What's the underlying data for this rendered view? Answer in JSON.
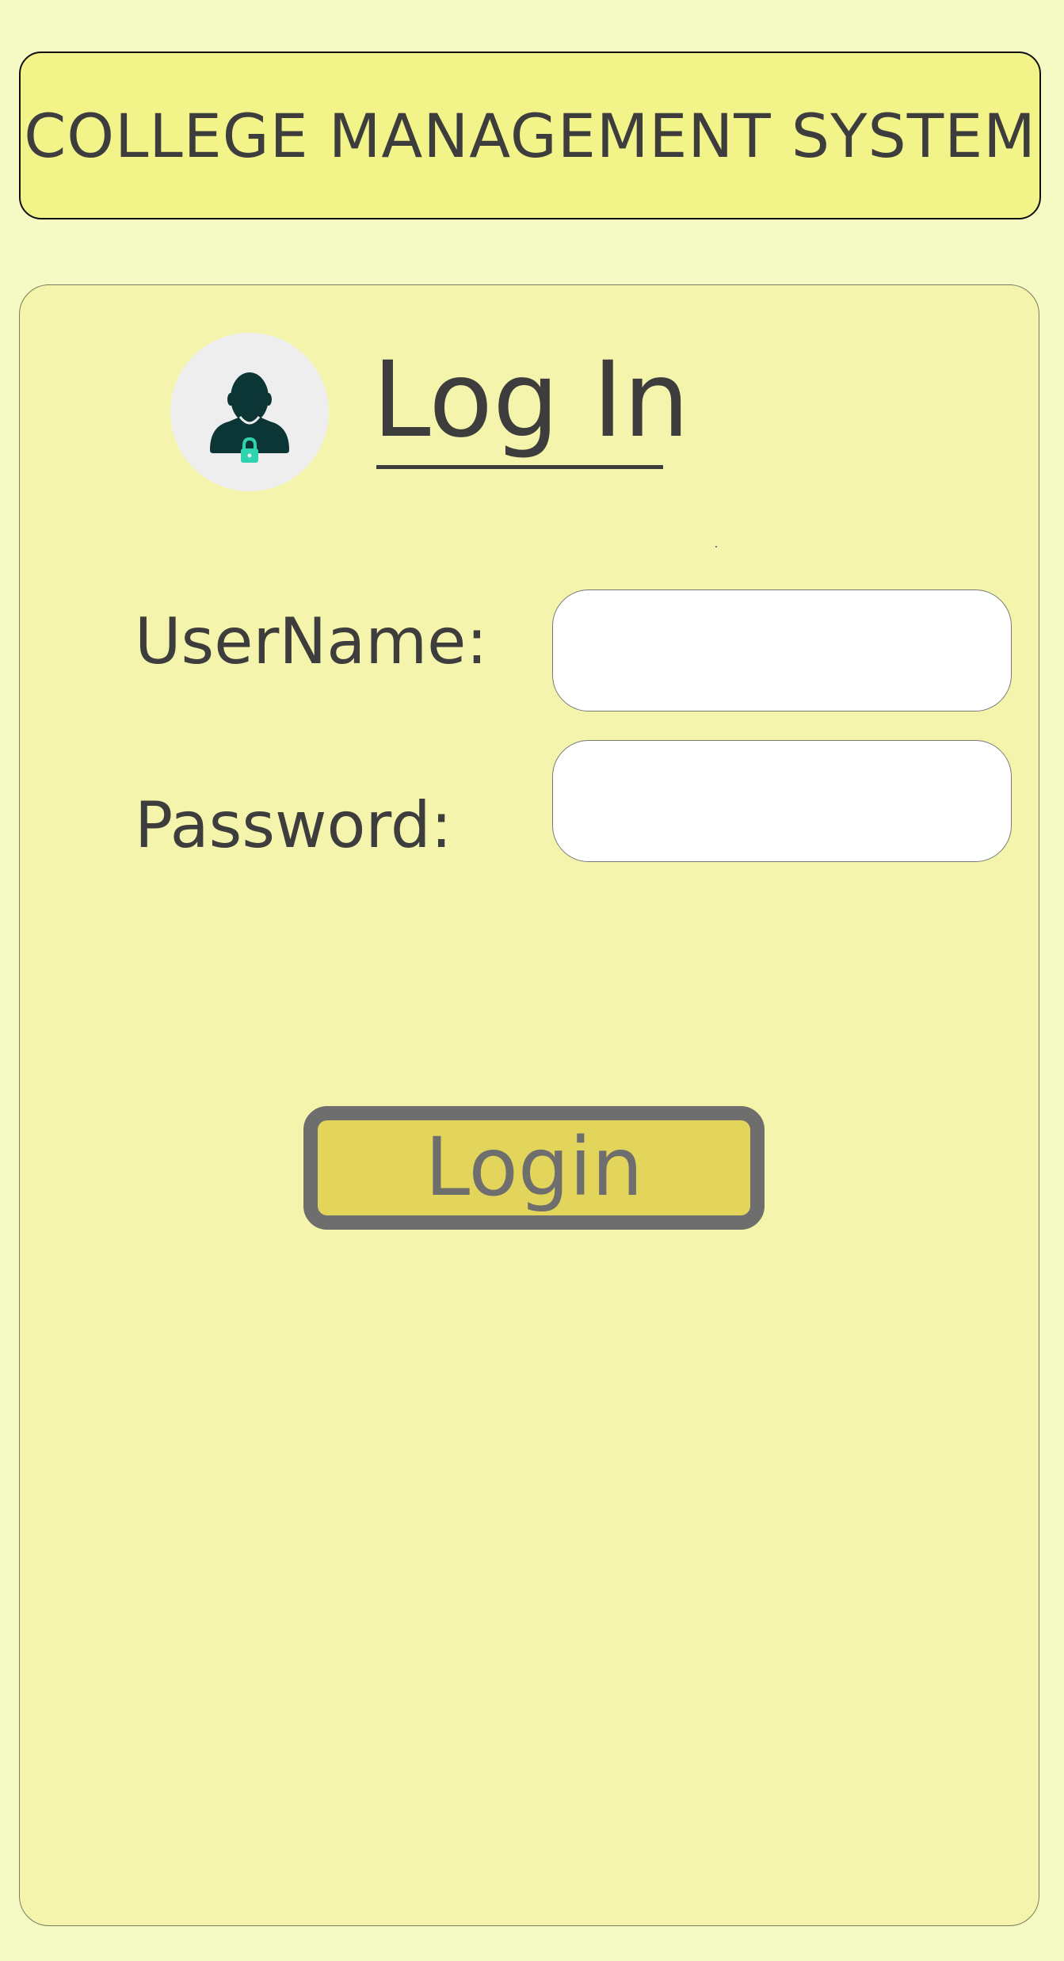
{
  "header": {
    "title": "COLLEGE MANAGEMENT SYSTEM"
  },
  "login_card": {
    "heading": "Log In",
    "avatar_icon": "user-lock-icon",
    "username_label": "UserName:",
    "username_value": "",
    "username_placeholder": "",
    "password_label": "Password:",
    "password_value": "",
    "password_placeholder": "",
    "login_button_label": "Login"
  },
  "colors": {
    "page_background": "#f5f9c4",
    "header_background": "#f2f48a",
    "card_background": "#f5f4ad",
    "button_background": "#e3d55c",
    "button_border": "#6e6e6e",
    "avatar_figure": "#0c3535",
    "lock_accent": "#2ed3b0",
    "text": "#3d3d3d"
  }
}
